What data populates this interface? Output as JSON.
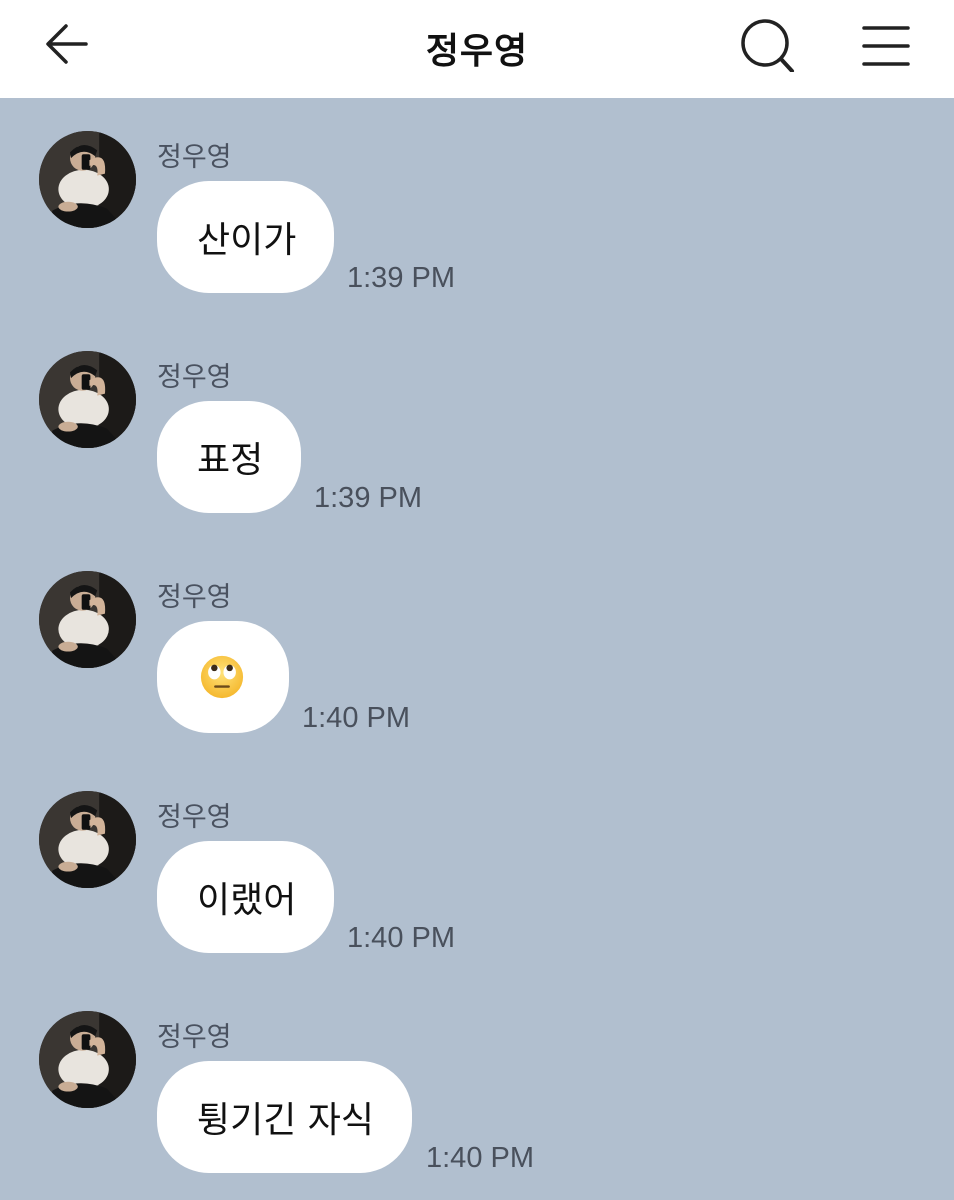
{
  "header": {
    "title": "정우영",
    "back_icon": "arrow-left-icon",
    "search_icon": "search-icon",
    "menu_icon": "menu-icon"
  },
  "colors": {
    "background": "#b1bfcf",
    "bubble": "#ffffff",
    "header": "#ffffff"
  },
  "messages": [
    {
      "sender": "정우영",
      "text": "산이가",
      "time": "1:39 PM"
    },
    {
      "sender": "정우영",
      "text": "표정",
      "time": "1:39 PM"
    },
    {
      "sender": "정우영",
      "text": "🙄",
      "time": "1:40 PM",
      "emoji": "face-with-rolling-eyes"
    },
    {
      "sender": "정우영",
      "text": "이랬어",
      "time": "1:40 PM"
    },
    {
      "sender": "정우영",
      "text": "튕기긴 자식",
      "time": "1:40 PM"
    }
  ]
}
